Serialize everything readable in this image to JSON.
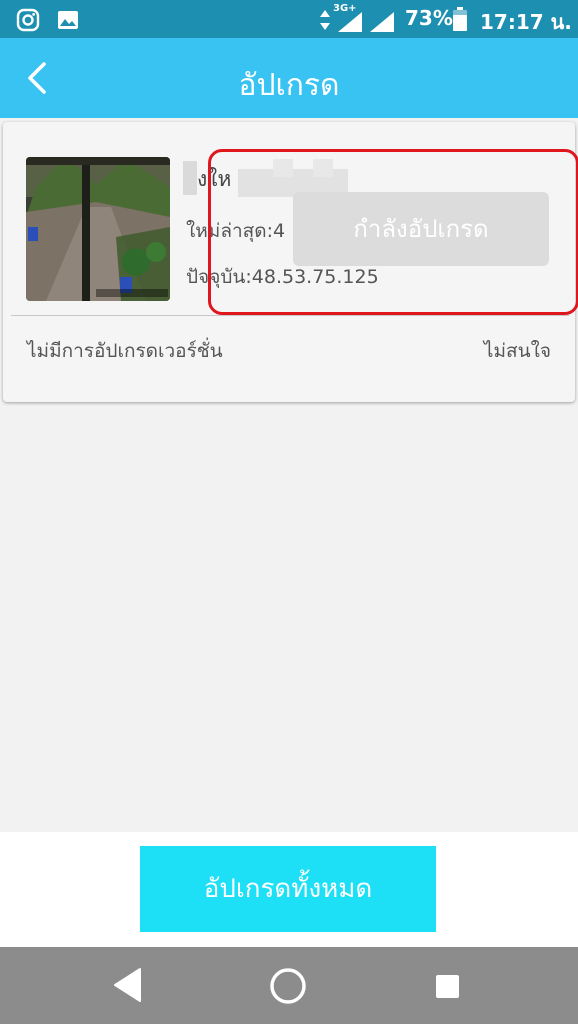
{
  "status_bar": {
    "network_label": "3G+",
    "battery_percent": "73%",
    "time": "17:17 น."
  },
  "header": {
    "title": "อัปเกรด"
  },
  "device": {
    "name_partial": "งให",
    "latest_version_label": "ใหม่ล่าสุด:4",
    "current_version_label": "ปัจจุบัน:48.53.75.125",
    "upgrade_status_button": "กำลังอัปเกรด",
    "no_upgrade_text": "ไม่มีการอัปเกรดเวอร์ชั่น",
    "ignore_label": "ไม่สนใจ"
  },
  "footer": {
    "upgrade_all_label": "อัปเกรดทั้งหมด"
  },
  "colors": {
    "status_bar": "#1d8fb0",
    "header": "#38c3f2",
    "primary_button": "#1de0f7",
    "annotation": "#e0161e",
    "nav_bar": "#8c8c8c"
  }
}
